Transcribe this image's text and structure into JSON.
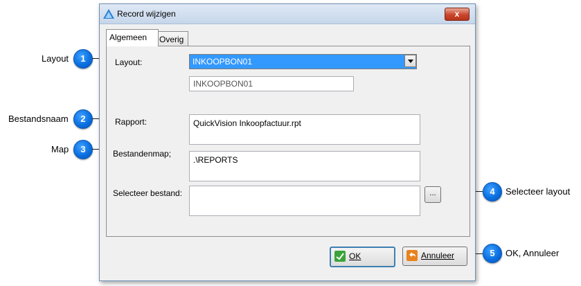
{
  "window": {
    "title": "Record wijzigen",
    "close_label": "x"
  },
  "tabs": [
    {
      "label": "Algemeen",
      "active": true
    },
    {
      "label": "Overig",
      "active": false
    }
  ],
  "form": {
    "layout_label": "Layout:",
    "layout_value": "INKOOPBON01",
    "layout_readonly_value": "INKOOPBON01",
    "rapport_label": "Rapport:",
    "rapport_value": "QuickVision Inkoopfactuur.rpt",
    "map_label": "Bestandenmap;",
    "map_value": ".\\REPORTS",
    "select_label": "Selecteer bestand:",
    "select_value": "",
    "browse_label": "..."
  },
  "buttons": {
    "ok_label": "OK",
    "cancel_label": "Annuleer"
  },
  "callouts": [
    {
      "number": "1",
      "label": "Layout"
    },
    {
      "number": "2",
      "label": "Bestandsnaam"
    },
    {
      "number": "3",
      "label": "Map"
    },
    {
      "number": "4",
      "label": "Selecteer layout"
    },
    {
      "number": "5",
      "label": "OK, Annuleer"
    }
  ],
  "colors": {
    "badge": "#0b6fe0",
    "selection": "#3399ff",
    "close_button": "#c9462c"
  }
}
